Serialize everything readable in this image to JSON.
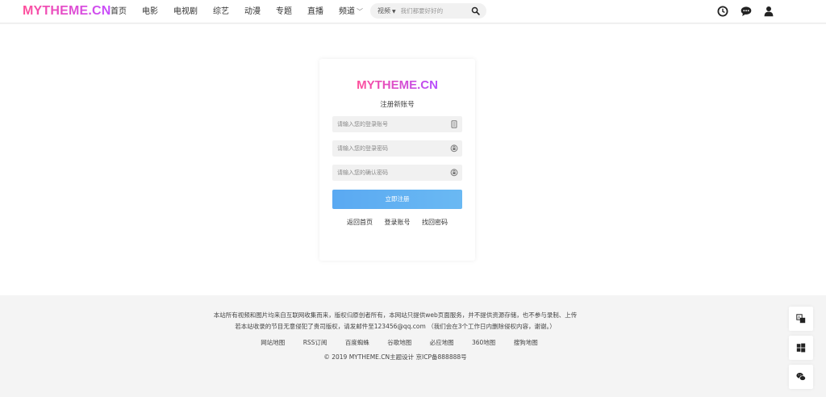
{
  "header": {
    "logo": "MYTHEME.CN",
    "nav": [
      "首页",
      "电影",
      "电视剧",
      "综艺",
      "动漫",
      "专题",
      "直播",
      "频道"
    ],
    "search": {
      "type": "视频",
      "placeholder": "我们都要好好的"
    },
    "icons": [
      "clock-icon",
      "chat-icon",
      "user-icon"
    ]
  },
  "register": {
    "logo": "MYTHEME.CN",
    "subtitle": "注册新账号",
    "account_placeholder": "请输入您的登录账号",
    "password_placeholder": "请输入您的登录密码",
    "confirm_placeholder": "请输入您的确认密码",
    "submit_label": "立即注册",
    "links": [
      "返回首页",
      "登录账号",
      "找回密码"
    ]
  },
  "footer": {
    "line1": "本站所有视频和图片均来自互联网收集而来，版权归原创者所有，本网站只提供web页面服务，并不提供资源存储，也不参与录制、上传",
    "line2": "若本站收录的节目无意侵犯了贵司版权，请发邮件至123456@qq.com （我们会在3个工作日内删除侵权内容，谢谢。）",
    "links": [
      "网站地图",
      "RSS订阅",
      "百度蜘蛛",
      "谷歌地图",
      "必应地图",
      "360地图",
      "搜狗地图"
    ],
    "copyright": "© 2019 MYTHEME.CN主题设计 京ICP备888888号"
  },
  "side_tools": [
    "translate-icon",
    "windows-icon",
    "wechat-icon"
  ],
  "colors": {
    "brand_pink": "#ff4f9a",
    "brand_purple": "#c64dff",
    "button_blue": "#5aa9f2"
  }
}
